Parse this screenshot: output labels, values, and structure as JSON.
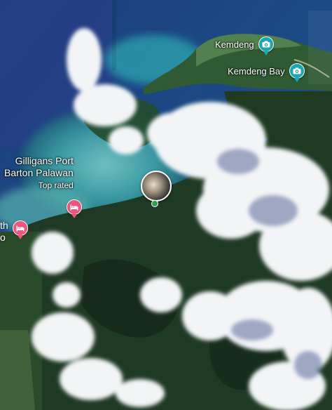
{
  "map": {
    "view": "satellite",
    "pois": [
      {
        "name": "Kemdeng",
        "type": "photo-spot",
        "icon": "camera-icon",
        "color": "#1aa6b3"
      },
      {
        "name": "Kemdeng Bay",
        "type": "photo-spot",
        "icon": "camera-icon",
        "color": "#1aa6b3"
      }
    ],
    "hotel": {
      "name_line1": "Gilligans Port",
      "name_line2": "Barton Palawan",
      "badge": "Top rated",
      "icon": "bed-icon",
      "color": "#e9577c"
    },
    "partial_hotel": {
      "label_line1": "th",
      "label_line2": "o",
      "icon": "bed-icon",
      "color": "#e9577c"
    },
    "photo_marker": {
      "icon": "user-photo-marker"
    }
  }
}
